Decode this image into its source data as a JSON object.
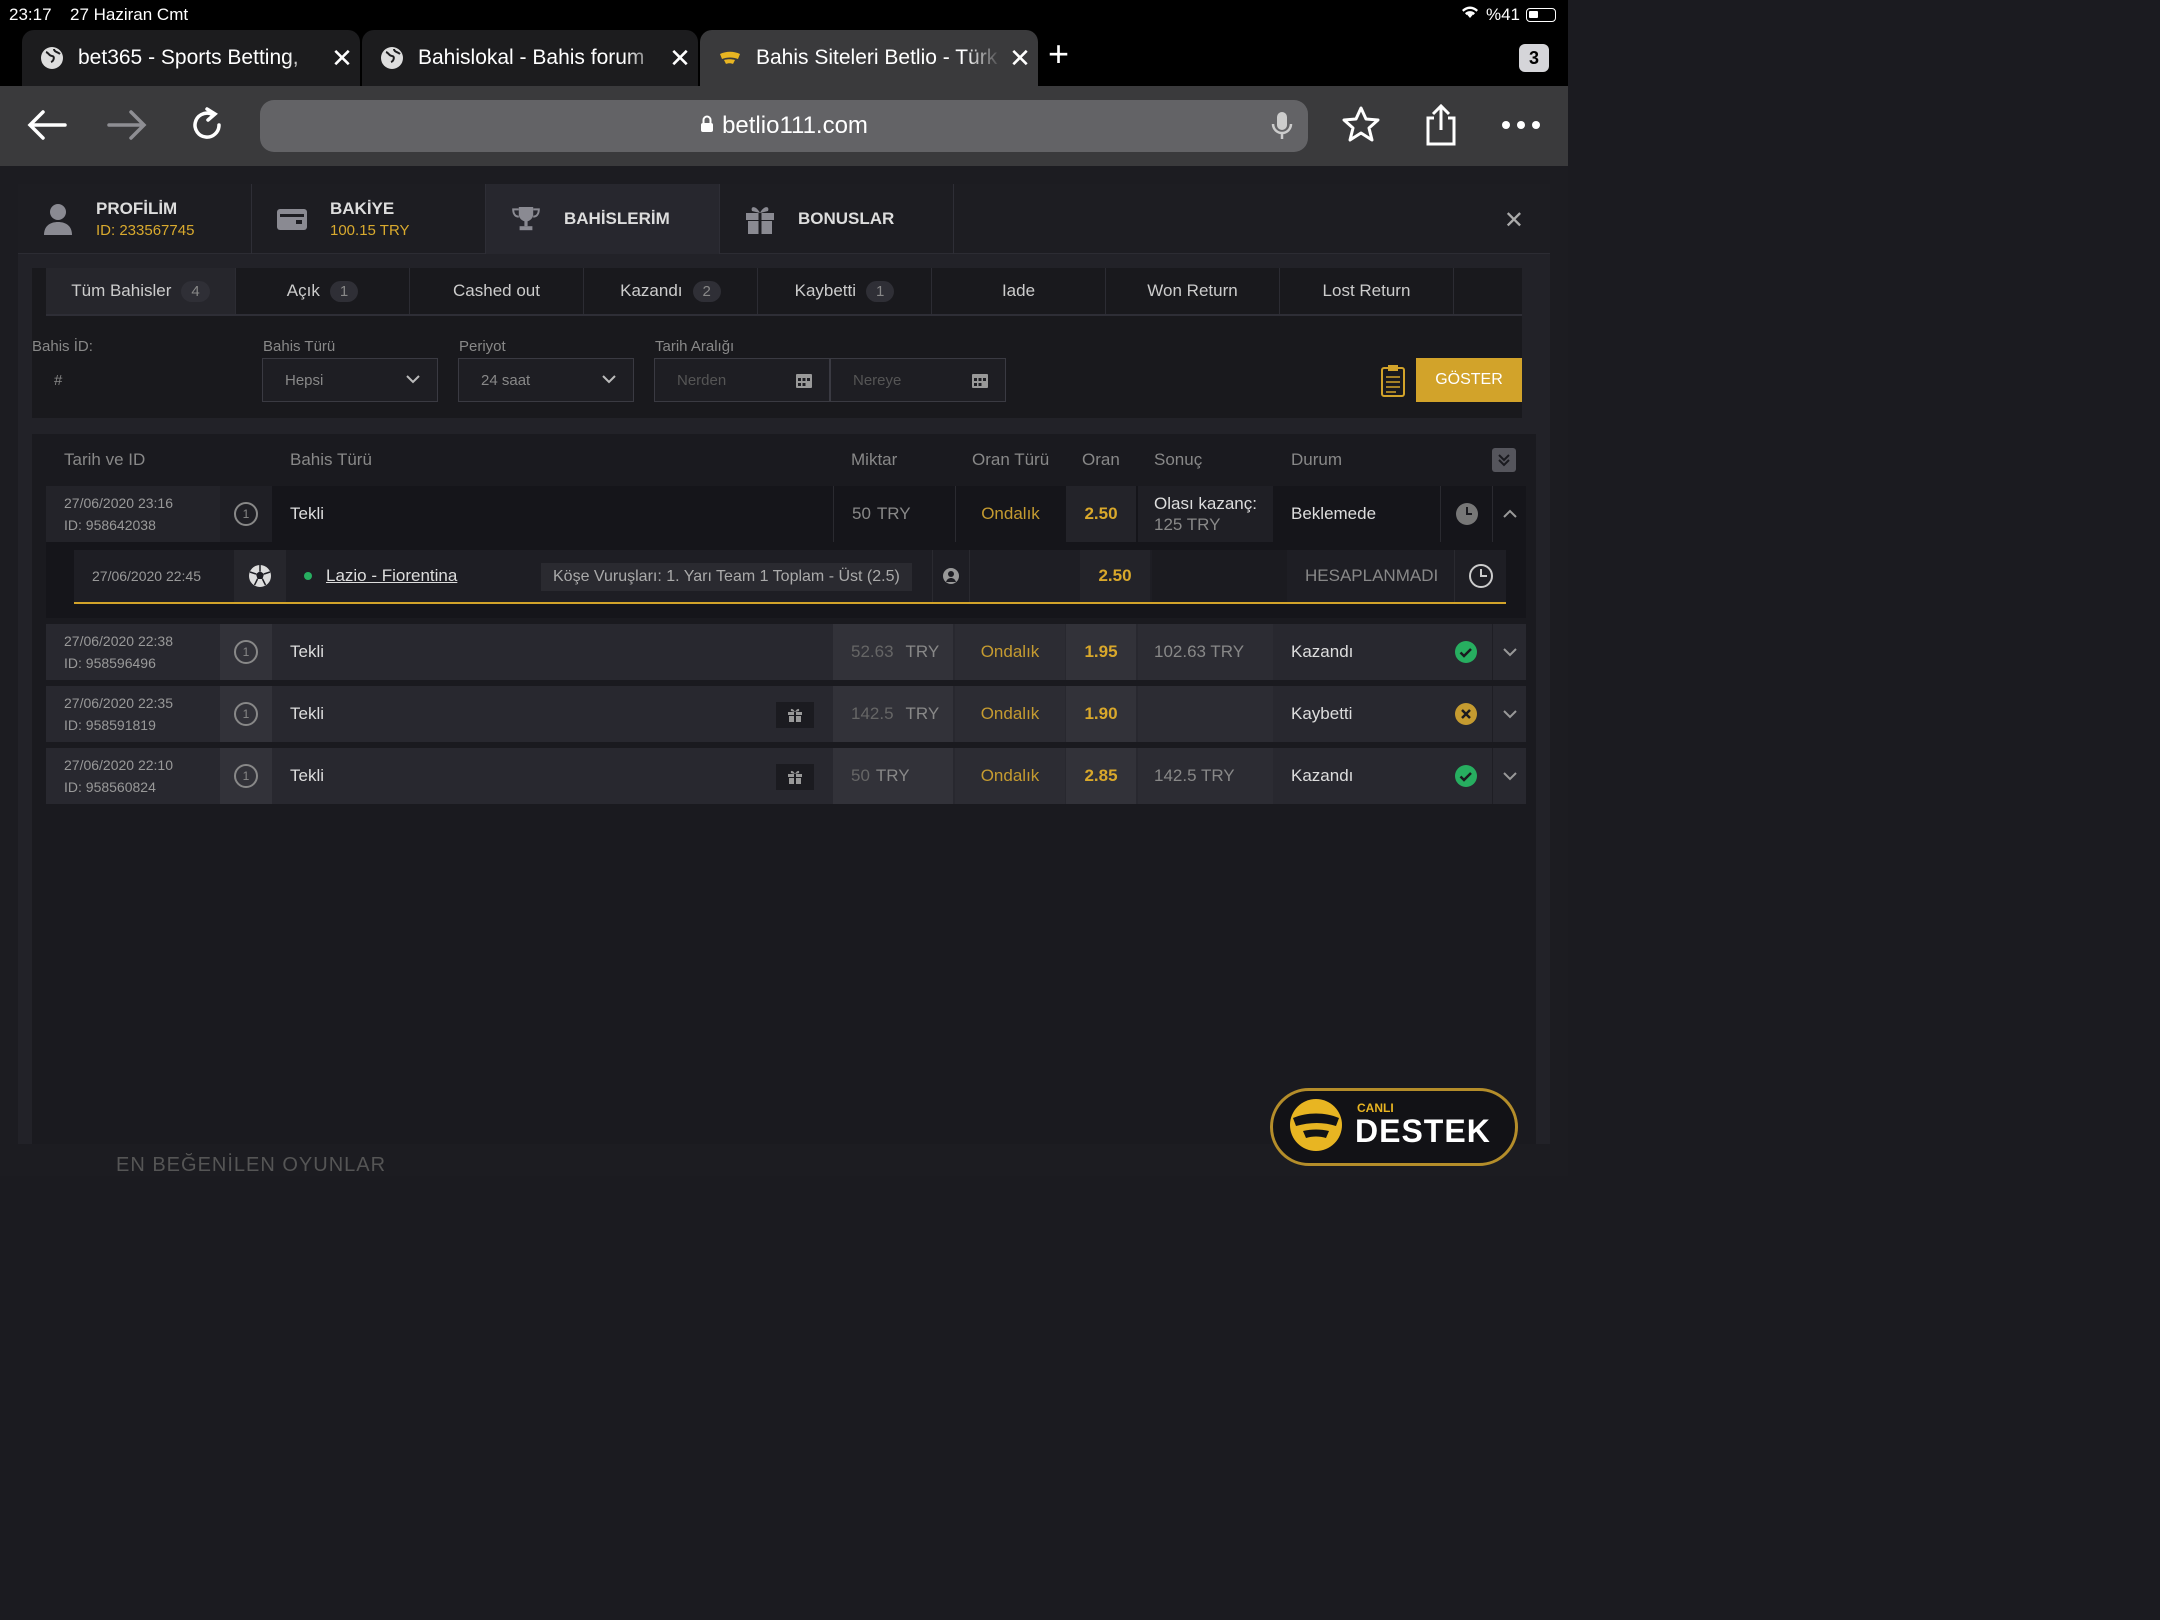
{
  "status": {
    "time": "23:17",
    "date": "27 Haziran Cmt",
    "battery": "%41"
  },
  "tabs": [
    {
      "title": "bet365 - Sports Betting,"
    },
    {
      "title": "Bahislokal - Bahis forum"
    },
    {
      "title": "Bahis Siteleri Betlio - Türk"
    }
  ],
  "tab_count": "3",
  "url": "betlio111.com",
  "modal_tabs": {
    "profile": {
      "label": "PROFİLİM",
      "sub": "ID: 233567745"
    },
    "balance": {
      "label": "BAKİYE",
      "sub": "100.15 TRY"
    },
    "bets": {
      "label": "BAHİSLERİM"
    },
    "bonus": {
      "label": "BONUSLAR"
    }
  },
  "filter_tabs": [
    {
      "label": "Tüm Bahisler",
      "count": "4"
    },
    {
      "label": "Açık",
      "count": "1"
    },
    {
      "label": "Cashed out",
      "count": ""
    },
    {
      "label": "Kazandı",
      "count": "2"
    },
    {
      "label": "Kaybetti",
      "count": "1"
    },
    {
      "label": "Iade",
      "count": ""
    },
    {
      "label": "Won Return",
      "count": ""
    },
    {
      "label": "Lost Return",
      "count": ""
    }
  ],
  "filters": {
    "bet_id_label": "Bahis İD:",
    "bet_id_placeholder": "#",
    "type_label": "Bahis Türü",
    "type_value": "Hepsi",
    "period_label": "Periyot",
    "period_value": "24 saat",
    "date_label": "Tarih Aralığı",
    "from_placeholder": "Nerden",
    "to_placeholder": "Nereye",
    "show_button": "GÖSTER"
  },
  "columns": {
    "date": "Tarih ve ID",
    "type": "Bahis Türü",
    "amount": "Miktar",
    "odd_type": "Oran Türü",
    "odd": "Oran",
    "result": "Sonuç",
    "status": "Durum"
  },
  "bets": [
    {
      "date": "27/06/2020 23:16",
      "id": "ID: 958642038",
      "num": "1",
      "type": "Tekli",
      "amount": "50",
      "currency": "TRY",
      "odd_type": "Ondalık",
      "odd": "2.50",
      "result_line1": "Olası kazanç:",
      "result_line2": "125 TRY",
      "status": "Beklemede"
    },
    {
      "date": "27/06/2020 22:38",
      "id": "ID: 958596496",
      "num": "1",
      "type": "Tekli",
      "amount": "52.63",
      "currency": "TRY",
      "odd_type": "Ondalık",
      "odd": "1.95",
      "result": "102.63 TRY",
      "status": "Kazandı"
    },
    {
      "date": "27/06/2020 22:35",
      "id": "ID: 958591819",
      "num": "1",
      "type": "Tekli",
      "amount": "142.5",
      "currency": "TRY",
      "odd_type": "Ondalık",
      "odd": "1.90",
      "result": "",
      "status": "Kaybetti"
    },
    {
      "date": "27/06/2020 22:10",
      "id": "ID: 958560824",
      "num": "1",
      "type": "Tekli",
      "amount": "50",
      "currency": "TRY",
      "odd_type": "Ondalık",
      "odd": "2.85",
      "result": "142.5 TRY",
      "status": "Kazandı"
    }
  ],
  "bet_detail": {
    "date": "27/06/2020 22:45",
    "match": "Lazio - Fiorentina",
    "market": "Köşe Vuruşları: 1. Yarı Team 1 Toplam - Üst (2.5)",
    "odd": "2.50",
    "status": "HESAPLANMADI"
  },
  "support": {
    "line1": "CANLI",
    "line2": "DESTEK"
  },
  "footer_text": "EN BEĞENİLEN OYUNLAR",
  "colors": {
    "accent": "#d2a32a",
    "win": "#27ae60",
    "lose": "#c59b30"
  }
}
